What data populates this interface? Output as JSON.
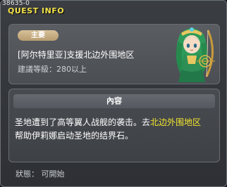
{
  "window": {
    "id_text": "38635-0",
    "title": "QUEST INFO"
  },
  "quest": {
    "tag": "主要",
    "name": "[阿尔特里亚]支援北边外围地区",
    "level_text": "建議等級：280以上"
  },
  "content": {
    "header": "內容",
    "desc_part1": "圣地遭到了高等翼人战舰的袭击。去",
    "desc_highlight": "北边外围地区",
    "desc_part2": "帮助伊莉娜启动圣地的结界石。"
  },
  "status": {
    "text": "狀態： 可開始"
  },
  "colors": {
    "title": "#f2e24a",
    "highlight": "#f3e62c",
    "badge": "#c7ab80"
  },
  "icons": {
    "portrait": "npc-portrait-green-hair-archer"
  }
}
